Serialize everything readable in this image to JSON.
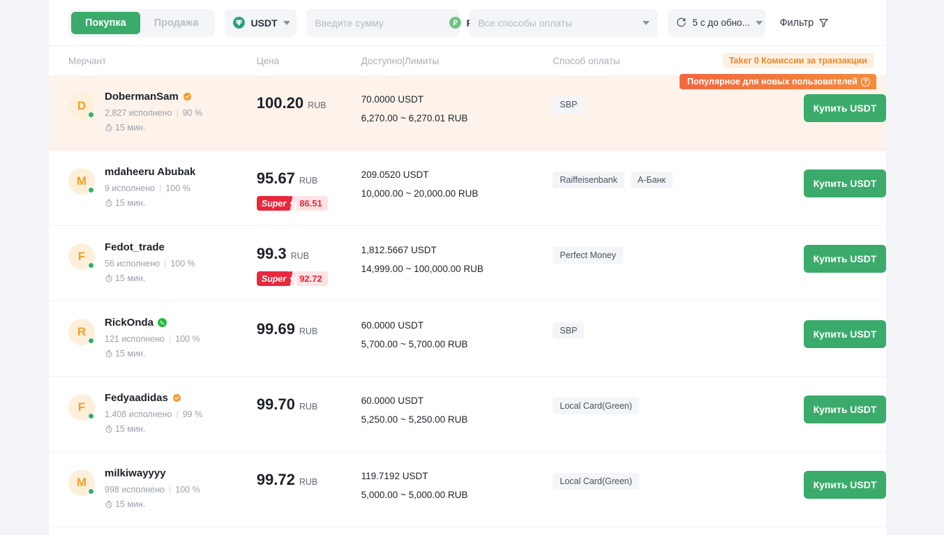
{
  "toolbar": {
    "buy_tab": "Покупка",
    "sell_tab": "Продажа",
    "coin": "USDT",
    "amount_placeholder": "Введите сумму",
    "amount_value": "",
    "fiat": "RUB",
    "payment_placeholder": "Все способы оплаты",
    "refresh_label": "5 с до обно...",
    "filter_label": "Фильтр",
    "icons": {
      "coin": "usdt-icon",
      "fiat": "rub-icon",
      "refresh": "refresh-icon",
      "filter": "filter-icon",
      "caret": "chevron-down-icon"
    },
    "colors": {
      "accent_green": "#3aab6b",
      "usdt_teal": "#26a17b",
      "rub_green": "#6fc37f"
    }
  },
  "table": {
    "headers": {
      "merchant": "Мерчант",
      "price": "Цена",
      "available": "Доступно|Лимиты",
      "payment": "Способ оплаты"
    },
    "taker_badge": "Taker 0 Комиссии за транзакции",
    "popular_badge": "Популярное для новых пользователей",
    "popular_help": "?",
    "buy_button": "Купить USDT",
    "rows": [
      {
        "initial": "D",
        "name": "DobermanSam",
        "badge": "verified-gear-icon",
        "orders": "2,827 исполнено",
        "completion": "90 %",
        "time": "15 мин.",
        "price": "100.20",
        "price_currency": "RUB",
        "super": null,
        "available": "70.0000 USDT",
        "limits": "6,270.00 ~ 6,270.01 RUB",
        "methods": [
          "SBP"
        ],
        "highlighted": true
      },
      {
        "initial": "M",
        "name": "mdaheeru Abubak",
        "badge": null,
        "orders": "9 исполнено",
        "completion": "100 %",
        "time": "15 мин.",
        "price": "95.67",
        "price_currency": "RUB",
        "super": {
          "label": "Super",
          "value": "86.51"
        },
        "available": "209.0520 USDT",
        "limits": "10,000.00 ~ 20,000.00 RUB",
        "methods": [
          "Raiffeisenbank",
          "А-Банк"
        ],
        "highlighted": false
      },
      {
        "initial": "F",
        "name": "Fedot_trade",
        "badge": null,
        "orders": "56 исполнено",
        "completion": "100 %",
        "time": "15 мин.",
        "price": "99.3",
        "price_currency": "RUB",
        "super": {
          "label": "Super",
          "value": "92.72"
        },
        "available": "1,812.5667 USDT",
        "limits": "14,999.00 ~ 100,000.00 RUB",
        "methods": [
          "Perfect Money"
        ],
        "highlighted": false
      },
      {
        "initial": "R",
        "name": "RickOnda",
        "badge": "whatsapp-icon",
        "orders": "121 исполнено",
        "completion": "100 %",
        "time": "15 мин.",
        "price": "99.69",
        "price_currency": "RUB",
        "super": null,
        "available": "60.0000 USDT",
        "limits": "5,700.00 ~ 5,700.00 RUB",
        "methods": [
          "SBP"
        ],
        "highlighted": false
      },
      {
        "initial": "F",
        "name": "Fedyaadidas",
        "badge": "verified-gear-icon",
        "orders": "1,408 исполнено",
        "completion": "99 %",
        "time": "15 мин.",
        "price": "99.70",
        "price_currency": "RUB",
        "super": null,
        "available": "60.0000 USDT",
        "limits": "5,250.00 ~ 5,250.00 RUB",
        "methods": [
          "Local Card(Green)"
        ],
        "highlighted": false
      },
      {
        "initial": "M",
        "name": "milkiwayyyy",
        "badge": null,
        "orders": "998 исполнено",
        "completion": "100 %",
        "time": "15 мин.",
        "price": "99.72",
        "price_currency": "RUB",
        "super": null,
        "available": "119.7192 USDT",
        "limits": "5,000.00 ~ 5,000.00 RUB",
        "methods": [
          "Local Card(Green)"
        ],
        "highlighted": false
      }
    ]
  }
}
